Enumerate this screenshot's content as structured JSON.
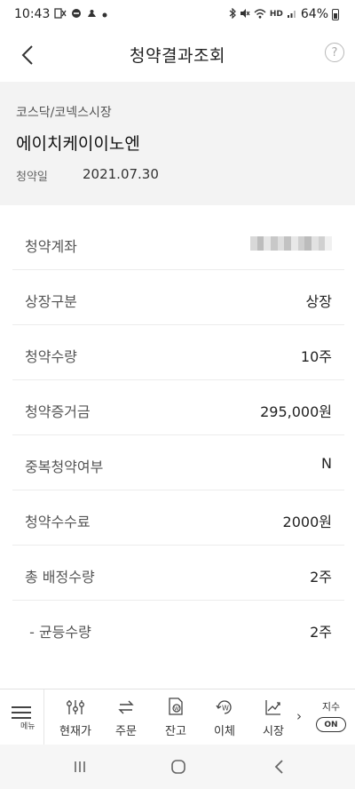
{
  "status_bar": {
    "time": "10:43",
    "left_icons": [
      "no-sim-icon",
      "dnd-icon",
      "app-notification-icon",
      "dot-icon"
    ],
    "right_icons": [
      "bluetooth-icon",
      "mute-icon",
      "wifi-icon",
      "hd-voice-icon",
      "signal-icon"
    ],
    "hd_label": "HD",
    "battery": "64%"
  },
  "header": {
    "title": "청약결과조회",
    "help_symbol": "?"
  },
  "summary": {
    "market": "코스닥/코넥스시장",
    "stock_name": "에이치케이이노엔",
    "date_label": "청약일",
    "date_value": "2021.07.30"
  },
  "details": [
    {
      "label": "청약계좌",
      "value": "",
      "masked": true
    },
    {
      "label": "상장구분",
      "value": "상장"
    },
    {
      "label": "청약수량",
      "value": "10주"
    },
    {
      "label": "청약증거금",
      "value": "295,000원"
    },
    {
      "label": "중복청약여부",
      "value": "N"
    },
    {
      "label": "청약수수료",
      "value": "2000원"
    },
    {
      "label": "총 배정수량",
      "value": "2주"
    },
    {
      "label": " - 균등수량",
      "value": "2주"
    }
  ],
  "bottom_nav": {
    "menu_label": "메뉴",
    "items": [
      {
        "label": "현재가",
        "icon": "price-sliders-icon"
      },
      {
        "label": "주문",
        "icon": "order-arrows-icon"
      },
      {
        "label": "잔고",
        "icon": "balance-doc-icon"
      },
      {
        "label": "이체",
        "icon": "transfer-won-icon"
      },
      {
        "label": "시장",
        "icon": "market-chart-icon"
      }
    ],
    "more_symbol": "›",
    "index_label": "지수",
    "index_toggle": "ON"
  },
  "colors": {
    "background": "#ffffff",
    "summary_bg": "#f3f3f3",
    "text_primary": "#222222",
    "text_secondary": "#555555",
    "divider": "#ececec"
  }
}
